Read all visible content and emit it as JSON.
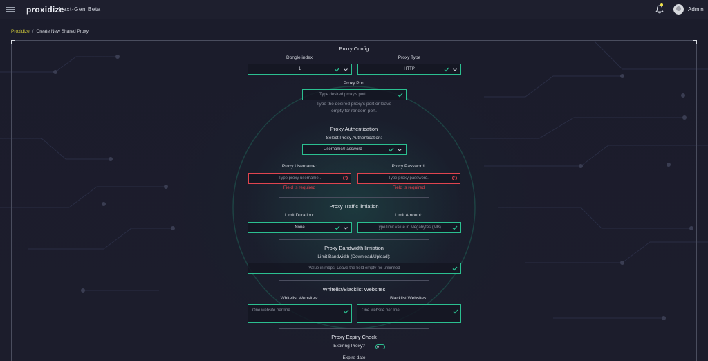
{
  "header": {
    "logo": "proxidize",
    "beta": "Next-Gen Beta",
    "user": "Admin"
  },
  "breadcrumb": {
    "parent": "Proxidize",
    "separator": "/",
    "current": "Create New Shared Proxy"
  },
  "proxy_config": {
    "title": "Proxy Config",
    "dongle_label": "Dongle index",
    "dongle_value": "1",
    "type_label": "Proxy Type",
    "type_value": "HTTP",
    "port_label": "Proxy Port",
    "port_placeholder": "Type desired proxy's port..",
    "port_help_1": "Type the desired proxy's port or leave",
    "port_help_2": "empty for random port."
  },
  "proxy_auth": {
    "title": "Proxy Authentication",
    "select_label": "Select Proxy Authentication:",
    "select_value": "Username/Password",
    "username_label": "Proxy Username:",
    "username_placeholder": "Type proxy username..",
    "username_error": "Field is required",
    "password_label": "Proxy Password:",
    "password_placeholder": "Type proxy password..",
    "password_error": "Field is required"
  },
  "traffic": {
    "title": "Proxy Traffic limiation",
    "duration_label": "Limit Duration:",
    "duration_value": "None",
    "amount_label": "Limit Amount:",
    "amount_placeholder": "Type limit value in Megabytes (MB)."
  },
  "bandwidth": {
    "title": "Proxy Bandwidth limiation",
    "label": "Limit Bandwidth (Download/Upload):",
    "placeholder": "Value in mbps. Leave the field empty for unlimited"
  },
  "lists": {
    "title": "Whitelist/Blacklist Websites",
    "whitelist_label": "Whitelist Websites:",
    "whitelist_placeholder": "One website per line",
    "blacklist_label": "Blacklist Websites:",
    "blacklist_placeholder": "One website per line"
  },
  "expiry": {
    "title": "Proxy Expiry Check",
    "expiring_label": "Expiring Proxy?",
    "expire_date_label": "Expire date"
  },
  "colors": {
    "accent": "#2bbf90",
    "error": "#e0444f",
    "breadcrumb": "#d4cd3a"
  }
}
